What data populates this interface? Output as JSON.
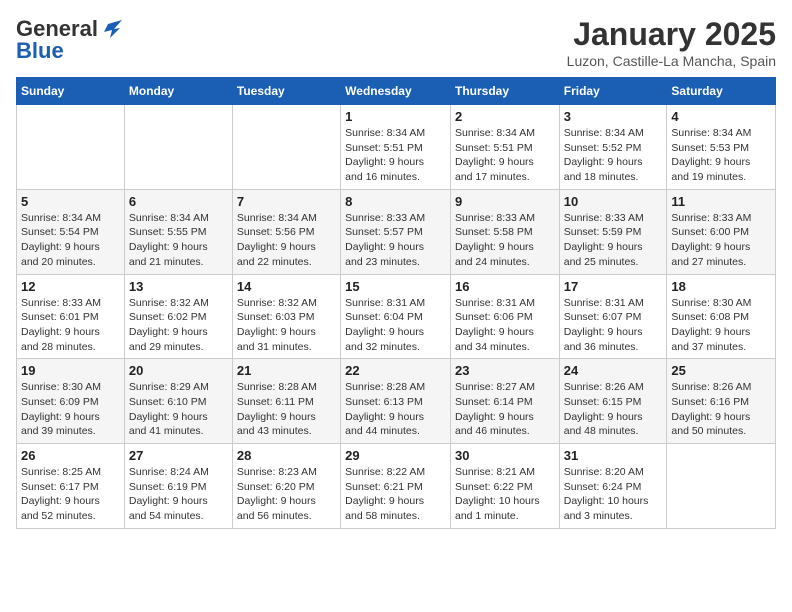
{
  "logo": {
    "general": "General",
    "blue": "Blue"
  },
  "header": {
    "month": "January 2025",
    "location": "Luzon, Castille-La Mancha, Spain"
  },
  "weekdays": [
    "Sunday",
    "Monday",
    "Tuesday",
    "Wednesday",
    "Thursday",
    "Friday",
    "Saturday"
  ],
  "weeks": [
    [
      {
        "day": "",
        "info": ""
      },
      {
        "day": "",
        "info": ""
      },
      {
        "day": "",
        "info": ""
      },
      {
        "day": "1",
        "info": "Sunrise: 8:34 AM\nSunset: 5:51 PM\nDaylight: 9 hours\nand 16 minutes."
      },
      {
        "day": "2",
        "info": "Sunrise: 8:34 AM\nSunset: 5:51 PM\nDaylight: 9 hours\nand 17 minutes."
      },
      {
        "day": "3",
        "info": "Sunrise: 8:34 AM\nSunset: 5:52 PM\nDaylight: 9 hours\nand 18 minutes."
      },
      {
        "day": "4",
        "info": "Sunrise: 8:34 AM\nSunset: 5:53 PM\nDaylight: 9 hours\nand 19 minutes."
      }
    ],
    [
      {
        "day": "5",
        "info": "Sunrise: 8:34 AM\nSunset: 5:54 PM\nDaylight: 9 hours\nand 20 minutes."
      },
      {
        "day": "6",
        "info": "Sunrise: 8:34 AM\nSunset: 5:55 PM\nDaylight: 9 hours\nand 21 minutes."
      },
      {
        "day": "7",
        "info": "Sunrise: 8:34 AM\nSunset: 5:56 PM\nDaylight: 9 hours\nand 22 minutes."
      },
      {
        "day": "8",
        "info": "Sunrise: 8:33 AM\nSunset: 5:57 PM\nDaylight: 9 hours\nand 23 minutes."
      },
      {
        "day": "9",
        "info": "Sunrise: 8:33 AM\nSunset: 5:58 PM\nDaylight: 9 hours\nand 24 minutes."
      },
      {
        "day": "10",
        "info": "Sunrise: 8:33 AM\nSunset: 5:59 PM\nDaylight: 9 hours\nand 25 minutes."
      },
      {
        "day": "11",
        "info": "Sunrise: 8:33 AM\nSunset: 6:00 PM\nDaylight: 9 hours\nand 27 minutes."
      }
    ],
    [
      {
        "day": "12",
        "info": "Sunrise: 8:33 AM\nSunset: 6:01 PM\nDaylight: 9 hours\nand 28 minutes."
      },
      {
        "day": "13",
        "info": "Sunrise: 8:32 AM\nSunset: 6:02 PM\nDaylight: 9 hours\nand 29 minutes."
      },
      {
        "day": "14",
        "info": "Sunrise: 8:32 AM\nSunset: 6:03 PM\nDaylight: 9 hours\nand 31 minutes."
      },
      {
        "day": "15",
        "info": "Sunrise: 8:31 AM\nSunset: 6:04 PM\nDaylight: 9 hours\nand 32 minutes."
      },
      {
        "day": "16",
        "info": "Sunrise: 8:31 AM\nSunset: 6:06 PM\nDaylight: 9 hours\nand 34 minutes."
      },
      {
        "day": "17",
        "info": "Sunrise: 8:31 AM\nSunset: 6:07 PM\nDaylight: 9 hours\nand 36 minutes."
      },
      {
        "day": "18",
        "info": "Sunrise: 8:30 AM\nSunset: 6:08 PM\nDaylight: 9 hours\nand 37 minutes."
      }
    ],
    [
      {
        "day": "19",
        "info": "Sunrise: 8:30 AM\nSunset: 6:09 PM\nDaylight: 9 hours\nand 39 minutes."
      },
      {
        "day": "20",
        "info": "Sunrise: 8:29 AM\nSunset: 6:10 PM\nDaylight: 9 hours\nand 41 minutes."
      },
      {
        "day": "21",
        "info": "Sunrise: 8:28 AM\nSunset: 6:11 PM\nDaylight: 9 hours\nand 43 minutes."
      },
      {
        "day": "22",
        "info": "Sunrise: 8:28 AM\nSunset: 6:13 PM\nDaylight: 9 hours\nand 44 minutes."
      },
      {
        "day": "23",
        "info": "Sunrise: 8:27 AM\nSunset: 6:14 PM\nDaylight: 9 hours\nand 46 minutes."
      },
      {
        "day": "24",
        "info": "Sunrise: 8:26 AM\nSunset: 6:15 PM\nDaylight: 9 hours\nand 48 minutes."
      },
      {
        "day": "25",
        "info": "Sunrise: 8:26 AM\nSunset: 6:16 PM\nDaylight: 9 hours\nand 50 minutes."
      }
    ],
    [
      {
        "day": "26",
        "info": "Sunrise: 8:25 AM\nSunset: 6:17 PM\nDaylight: 9 hours\nand 52 minutes."
      },
      {
        "day": "27",
        "info": "Sunrise: 8:24 AM\nSunset: 6:19 PM\nDaylight: 9 hours\nand 54 minutes."
      },
      {
        "day": "28",
        "info": "Sunrise: 8:23 AM\nSunset: 6:20 PM\nDaylight: 9 hours\nand 56 minutes."
      },
      {
        "day": "29",
        "info": "Sunrise: 8:22 AM\nSunset: 6:21 PM\nDaylight: 9 hours\nand 58 minutes."
      },
      {
        "day": "30",
        "info": "Sunrise: 8:21 AM\nSunset: 6:22 PM\nDaylight: 10 hours\nand 1 minute."
      },
      {
        "day": "31",
        "info": "Sunrise: 8:20 AM\nSunset: 6:24 PM\nDaylight: 10 hours\nand 3 minutes."
      },
      {
        "day": "",
        "info": ""
      }
    ]
  ]
}
